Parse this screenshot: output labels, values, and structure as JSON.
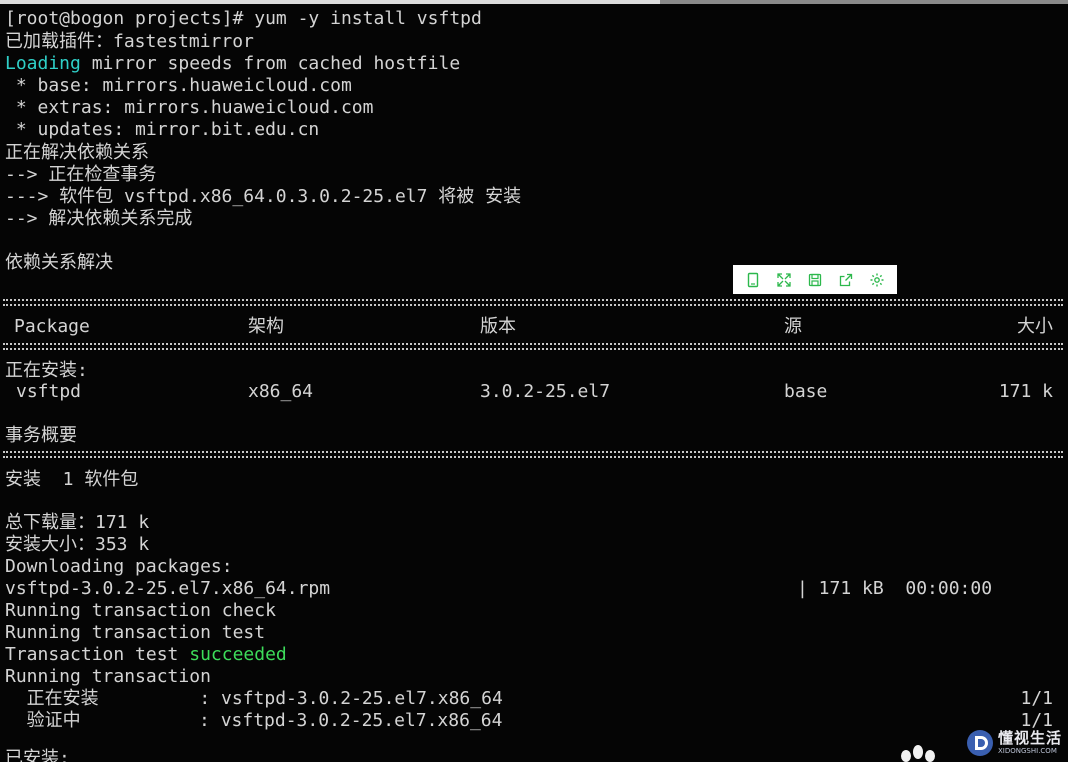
{
  "terminal": {
    "lines": {
      "l1": "[root@bogon projects]# yum -y install vsftpd",
      "l2": "已加载插件：fastestmirror",
      "l3_a": "Loading",
      "l3_b": " mirror speeds from cached hostfile",
      "l4": " * base: mirrors.huaweicloud.com",
      "l5": " * extras: mirrors.huaweicloud.com",
      "l6": " * updates: mirror.bit.edu.cn",
      "l7": "正在解决依赖关系",
      "l8": "--> 正在检查事务",
      "l9": "---> 软件包 vsftpd.x86_64.0.3.0.2-25.el7 将被 安装",
      "l10": "--> 解决依赖关系完成",
      "l11": "依赖关系解决",
      "installing_header": "正在安装:",
      "summary_title": "事务概要",
      "summary_install": "安装  1 软件包",
      "total_download": "总下载量：171 k",
      "install_size": "安装大小：353 k",
      "downloading": "Downloading packages:",
      "rpm_file": "vsftpd-3.0.2-25.el7.x86_64.rpm",
      "rpm_progress": "| 171 kB  00:00:00",
      "run_check": "Running transaction check",
      "run_test": "Running transaction test",
      "test_a": "Transaction test ",
      "test_b": "succeeded",
      "run_transaction": "Running transaction",
      "step_install_label": "  正在安装",
      "step_install_pkg": "    : vsftpd-3.0.2-25.el7.x86_64",
      "step_install_count": "1/1",
      "step_verify_label": "  验证中",
      "step_verify_pkg": "      : vsftpd-3.0.2-25.el7.x86_64",
      "step_verify_count": "1/1",
      "installed_partial": "已安装:"
    },
    "table": {
      "headers": {
        "package": "Package",
        "arch": "架构",
        "version": "版本",
        "repo": "源",
        "size": "大小"
      },
      "row": {
        "package": "vsftpd",
        "arch": "x86_64",
        "version": "3.0.2-25.el7",
        "repo": "base",
        "size": "171 k"
      }
    },
    "colors": {
      "background": "#050505",
      "text": "#d4d4d4",
      "loading": "#2fd0c8",
      "succeeded": "#3ddc5a"
    }
  },
  "toolbar": {
    "icons": [
      "phone-icon",
      "expand-icon",
      "save-icon",
      "share-icon",
      "settings-icon"
    ],
    "accent": "#2cb84c"
  },
  "watermark": {
    "cn": "懂视生活",
    "en": "XIDONGSHI.COM"
  }
}
